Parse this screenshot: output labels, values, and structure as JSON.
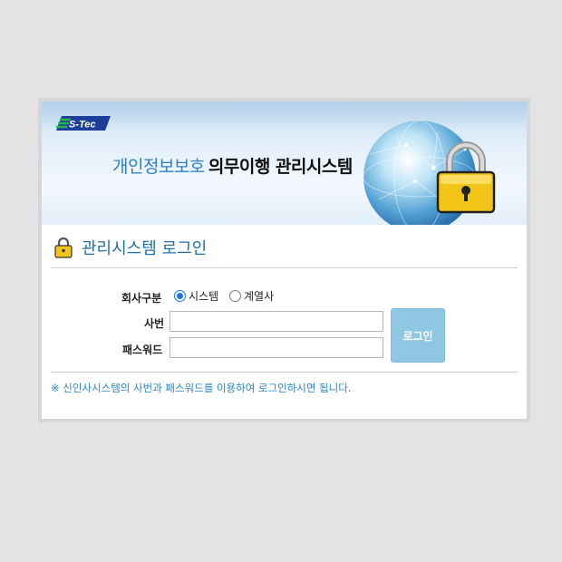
{
  "banner": {
    "logo_text": "S-Tec",
    "title_part1": "개인정보보호",
    "title_part2": "의무이행 관리시스템"
  },
  "login": {
    "title": "관리시스템 로그인",
    "company_label": "회사구분",
    "options": [
      "시스템",
      "계열사"
    ],
    "selected_option": "시스템",
    "id_label": "사번",
    "id_value": "",
    "password_label": "패스워드",
    "password_value": "",
    "login_button": "로그인"
  },
  "notice": "※ 신인사시스템의 사번과 패스워드를 이용하여 로그인하시면 됩니다.",
  "colors": {
    "accent": "#2e7fc4",
    "button": "#8fc6e2",
    "notice": "#2a86c4"
  }
}
